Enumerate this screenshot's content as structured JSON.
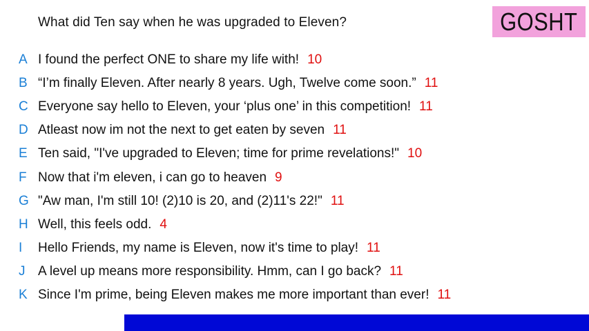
{
  "question": "What did Ten say when he was upgraded to Eleven?",
  "brand": "GOSHT",
  "colors": {
    "letter": "#1a7fd6",
    "score": "#e01010",
    "brand_bg": "#f2a2dc",
    "bar": "#0008d6"
  },
  "answers": [
    {
      "letter": "A",
      "text": "I found the perfect ONE to share my life with!",
      "score": "10"
    },
    {
      "letter": "B",
      "text": " “I’m finally Eleven. After nearly 8 years. Ugh, Twelve come soon.”",
      "score": "11"
    },
    {
      "letter": "C",
      "text": "Everyone say hello to Eleven, your ‘plus one’ in this competition!",
      "score": "11"
    },
    {
      "letter": "D",
      "text": "Atleast  now im not the next to get eaten by seven",
      "score": "11"
    },
    {
      "letter": "E",
      "text": "Ten said, \"I've upgraded to Eleven; time for prime revelations!\"",
      "score": "10"
    },
    {
      "letter": "F",
      "text": "Now that i'm eleven, i can go to heaven",
      "score": "9"
    },
    {
      "letter": "G",
      "text": "\"Aw man, I'm still 10! (2)10 is 20, and (2)11's 22!\"",
      "score": "11"
    },
    {
      "letter": "H",
      "text": "Well, this feels odd.",
      "score": "4"
    },
    {
      "letter": "I",
      "text": "Hello Friends, my name is Eleven, now it's time to play!",
      "score": "11"
    },
    {
      "letter": "J",
      "text": "A level up means more responsibility. Hmm, can I go back?",
      "score": "11"
    },
    {
      "letter": "K",
      "text": "Since I'm prime, being Eleven makes me more important than ever!",
      "score": "11"
    }
  ]
}
